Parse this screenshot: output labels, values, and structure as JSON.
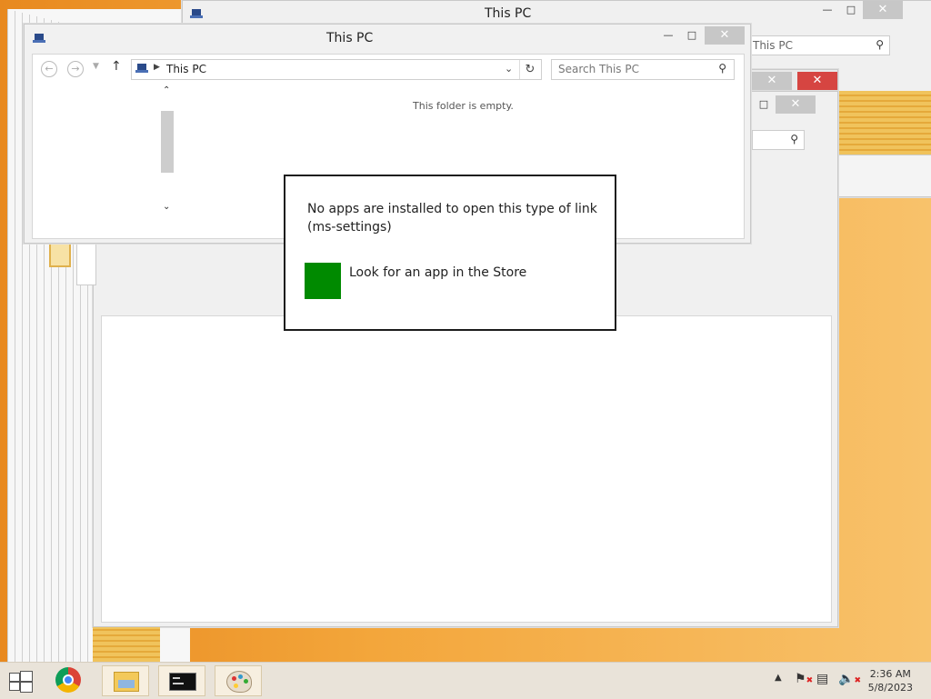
{
  "desktop": {},
  "back_window": {
    "title": "This PC",
    "search_placeholder": "This PC"
  },
  "explorer": {
    "title": "This PC",
    "address": "This PC",
    "search_placeholder": "Search This PC",
    "empty_message": "This folder is empty."
  },
  "dialog": {
    "message": "No apps are installed to open this type of link\n(ms-settings)",
    "store_label": "Look for an app in the Store"
  },
  "taskbar": {
    "apps": [
      {
        "name": "start"
      },
      {
        "name": "chrome"
      },
      {
        "name": "file-explorer"
      },
      {
        "name": "command-prompt"
      },
      {
        "name": "paint"
      }
    ],
    "time": "2:36 AM",
    "date": "5/8/2023"
  }
}
